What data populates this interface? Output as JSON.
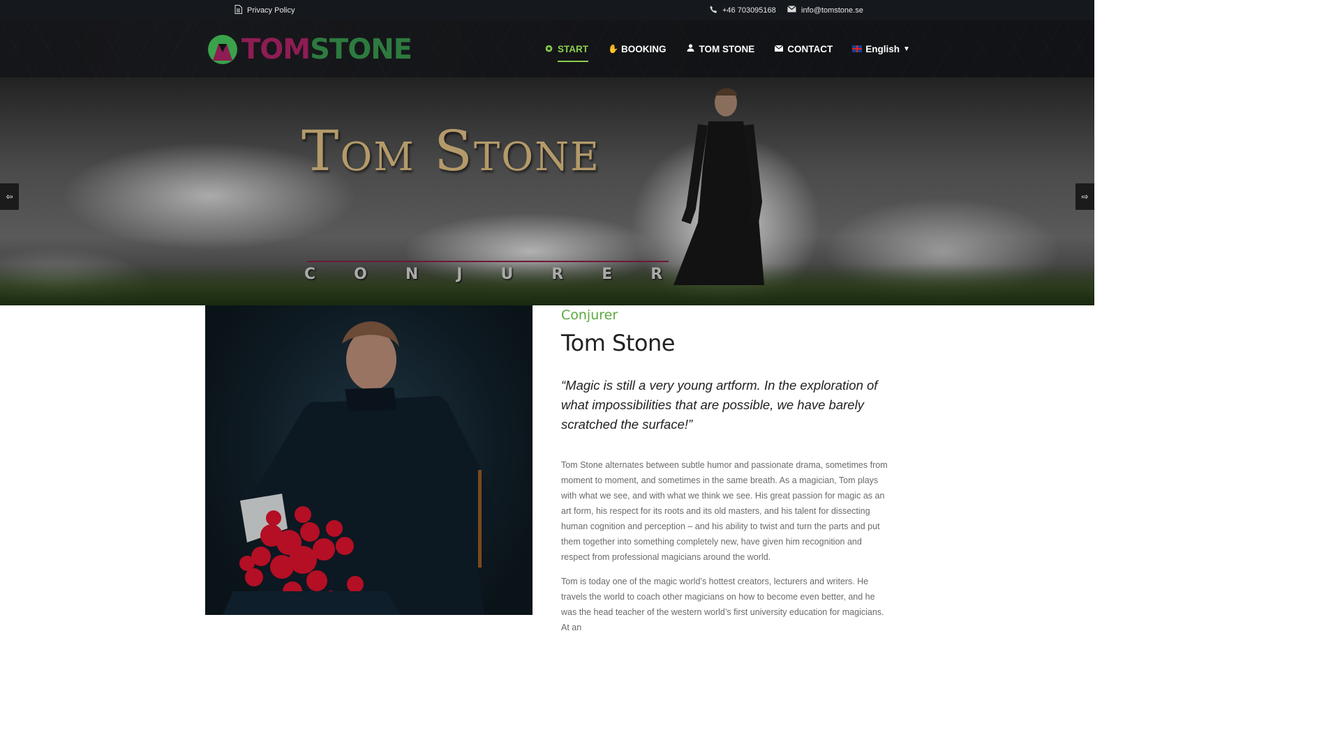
{
  "topbar": {
    "privacy": "Privacy Policy",
    "phone": "+46 703095168",
    "email": "info@tomstone.se"
  },
  "logo": {
    "tom": "TOM",
    "stone": "STONE"
  },
  "nav": {
    "items": [
      {
        "label": "START",
        "icon": "home-icon",
        "active": true
      },
      {
        "label": "BOOKING",
        "icon": "hand-icon"
      },
      {
        "label": "TOM STONE",
        "icon": "user-icon"
      },
      {
        "label": "CONTACT",
        "icon": "envelope-icon"
      }
    ],
    "language": "English"
  },
  "hero": {
    "title": "Tom Stone",
    "subtitle": "CONJURER"
  },
  "content": {
    "kicker": "Conjurer",
    "name": "Tom Stone",
    "quote": "“Magic is still a very young artform. In the exploration of what impossibilities that are possible, we have barely scratched the surface!”",
    "paragraph1": "Tom Stone alternates between subtle humor and passionate drama, sometimes from moment to moment, and sometimes in the same breath. As a magician, Tom plays with what we see, and with what we think we see. His great passion for magic as an art form, his respect for its roots and its old masters, and his talent for dissecting human cognition and perception – and his ability to twist and turn the parts and put them together into something completely new, have given him recognition and respect from professional magicians around the world.",
    "paragraph2": "Tom is today one of the magic world’s hottest creators, lecturers and writers. He travels the world to coach other magicians on how to become even better, and he was the head teacher of the western world’s first university education for magicians. At an"
  },
  "colors": {
    "accent_green": "#8ccf4d",
    "kicker_green": "#5aab3c",
    "brand_purple": "#8e1d54",
    "brand_green": "#2d7a3f"
  }
}
